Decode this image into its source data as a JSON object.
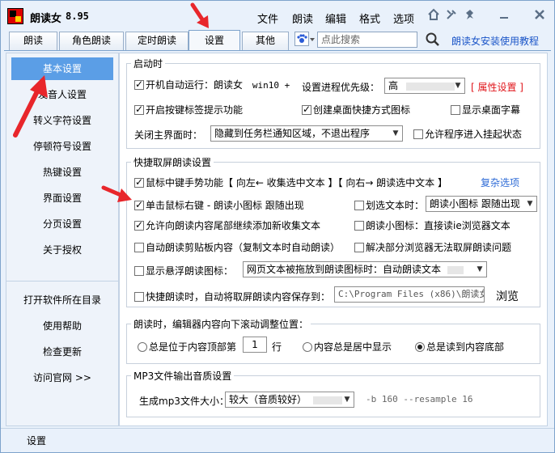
{
  "app": {
    "title": "朗读女",
    "version": "8.95"
  },
  "menu": [
    "文件",
    "朗读",
    "编辑",
    "格式",
    "选项"
  ],
  "title_icons": [
    "home-icon",
    "tools-icon",
    "pin-icon",
    "minimize-icon",
    "close-icon"
  ],
  "tabs": [
    "朗读",
    "角色朗读",
    "定时朗读",
    "设置",
    "其他"
  ],
  "active_tab": "设置",
  "search": {
    "placeholder": "点此搜索"
  },
  "help_link": "朗读女安装使用教程",
  "sidebar": {
    "items": [
      "基本设置",
      "发音人设置",
      "转义字符设置",
      "停顿符号设置",
      "热键设置",
      "界面设置",
      "分页设置",
      "关于授权"
    ],
    "links": [
      "打开软件所在目录",
      "使用帮助",
      "检查更新",
      "访问官网 >>"
    ]
  },
  "startup": {
    "title": "启动时",
    "autorun_label": "开机自动运行：朗读女",
    "autorun_os": "win10 +",
    "priority_label": "设置进程优先级：",
    "priority_value": "高",
    "property_link": "[ 属性设置 ]",
    "caret_label": "开启按键标签提示功能",
    "desktop_shortcut_label": "创建桌面快捷方式图标",
    "desktop_subtitle_label": "显示桌面字幕",
    "close_label": "关闭主界面时：",
    "close_value": "隐藏到任务栏通知区域，不退出程序",
    "suspend_label": "允许程序进入挂起状态"
  },
  "capture": {
    "title": "快捷取屏朗读设置",
    "middle_gesture_label": "鼠标中键手势功能【 向左← 收集选中文本 】【 向右→ 朗读选中文本 】",
    "complex_link": "复杂选项",
    "right_click_label": "单击鼠标右键 - 朗读小图标 跟随出现",
    "select_text_label": "划选文本时：",
    "select_text_value": "朗读小图标 跟随出现",
    "append_label": "允许向朗读内容尾部继续添加新收集文本",
    "icon_direct_label": "朗读小图标：直接读ie浏览器文本",
    "clipboard_label": "自动朗读剪贴板内容（复制文本时自动朗读）",
    "browser_fix_label": "解决部分浏览器无法取屏朗读问题",
    "float_icon_label": "显示悬浮朗读图标：",
    "float_icon_value": "网页文本被拖放到朗读图标时：自动朗读文本",
    "save_label": "快捷朗读时，自动将取屏朗读内容保存到：",
    "save_path": "C:\\Program Files (x86)\\朗读女\\",
    "browse_label": "浏览"
  },
  "scroll": {
    "title": "朗读时，编辑器内容向下滚动调整位置：",
    "opt_top_prefix": "总是位于内容顶部第",
    "opt_top_line": "1",
    "opt_top_suffix": "行",
    "opt_center": "内容总是居中显示",
    "opt_bottom": "总是读到内容底部",
    "selected": "opt_bottom"
  },
  "mp3": {
    "title": "MP3文件输出音质设置",
    "size_label": "生成mp3文件大小：",
    "size_value": "较大（音质较好）",
    "params": "-b 160 --resample 16"
  },
  "status_text": "设置",
  "colors": {
    "accent": "#5b9ee6",
    "link": "#1a55c8",
    "warning": "#e0161b",
    "annotation_arrow": "#e8262b"
  }
}
